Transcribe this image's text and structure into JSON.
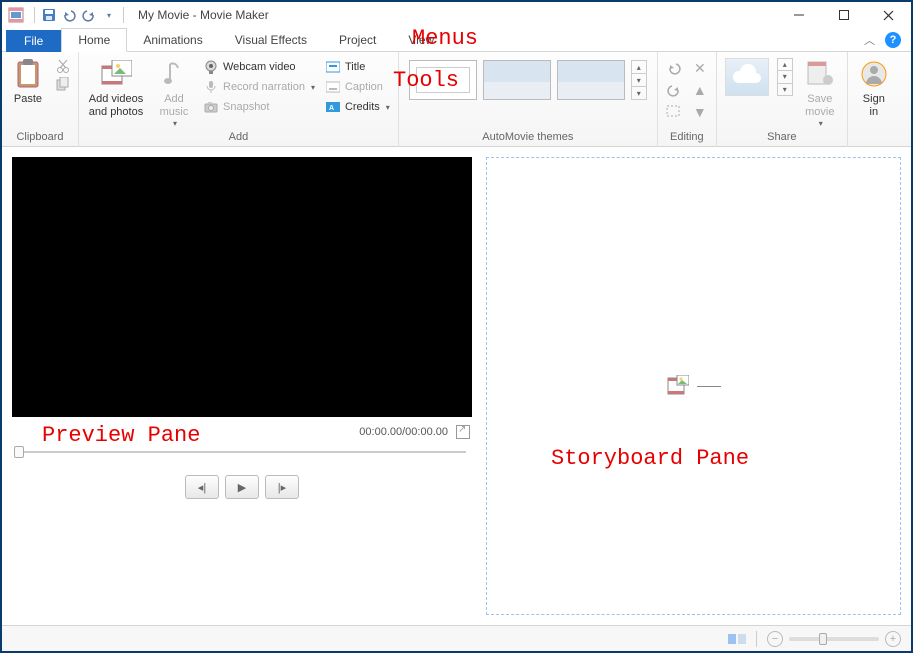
{
  "title": "My Movie - Movie Maker",
  "menus": {
    "file": "File",
    "tabs": [
      "Home",
      "Animations",
      "Visual Effects",
      "Project",
      "View"
    ]
  },
  "ribbon": {
    "clipboard": {
      "paste": "Paste",
      "label": "Clipboard"
    },
    "add": {
      "add_videos": "Add videos\nand photos",
      "add_music": "Add\nmusic",
      "webcam": "Webcam video",
      "record": "Record narration",
      "snapshot": "Snapshot",
      "title_btn": "Title",
      "caption": "Caption",
      "credits": "Credits",
      "label": "Add"
    },
    "themes": {
      "label": "AutoMovie themes"
    },
    "editing": {
      "label": "Editing"
    },
    "share": {
      "save_movie": "Save\nmovie",
      "label": "Share"
    },
    "signin": "Sign\nin"
  },
  "preview": {
    "timecode": "00:00.00/00:00.00"
  },
  "annotations": {
    "menus": "Menus",
    "tools": "Tools",
    "preview": "Preview Pane",
    "storyboard": "Storyboard Pane"
  }
}
